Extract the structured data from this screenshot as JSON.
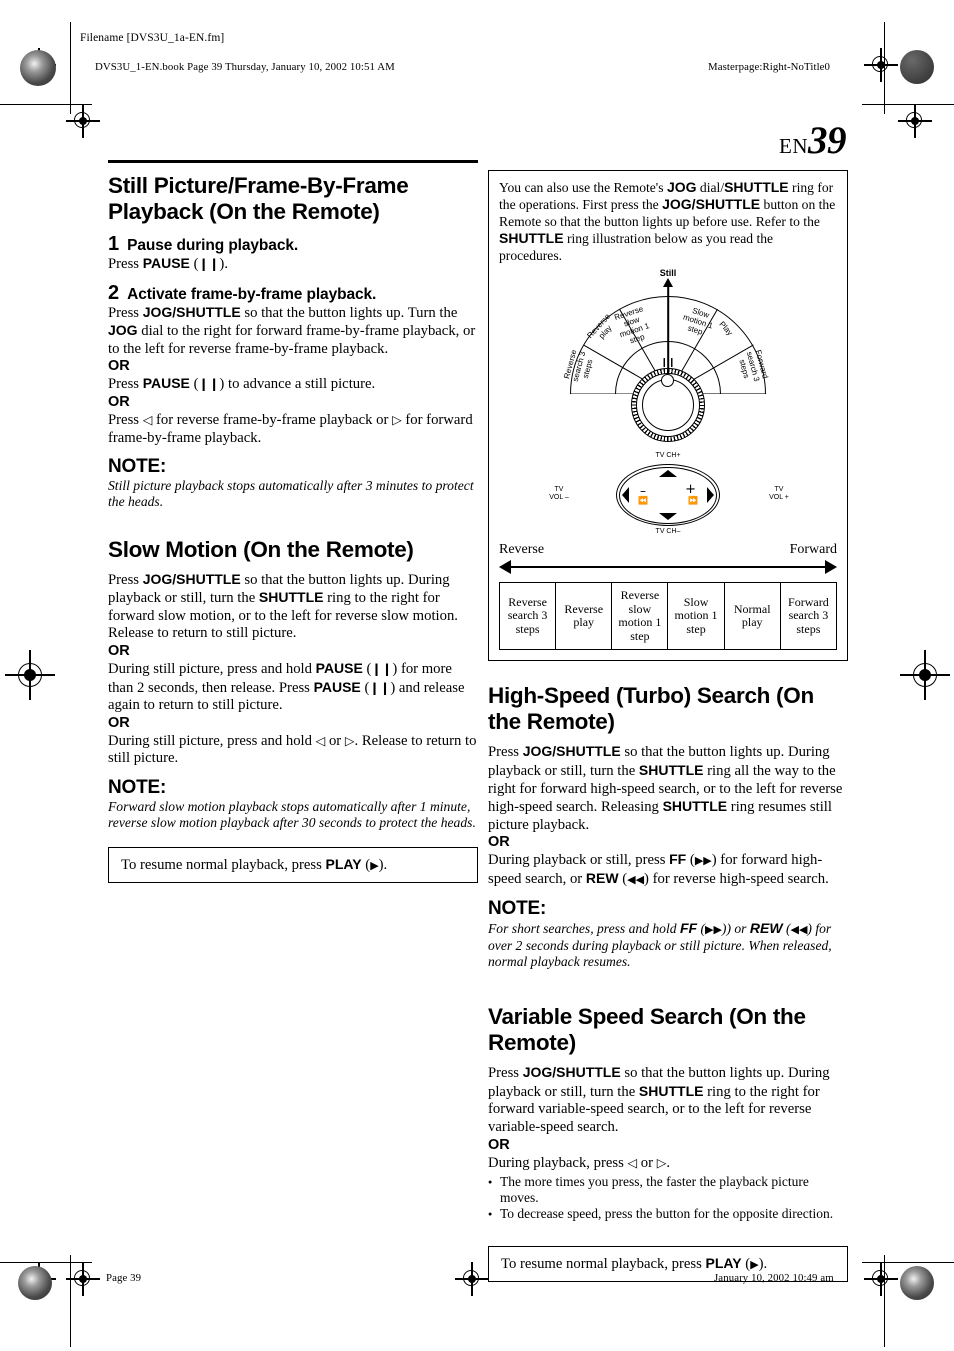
{
  "header": {
    "filename_label": "Filename [DVS3U_1a-EN.fm]",
    "book_line": "DVS3U_1-EN.book  Page 39  Thursday, January 10, 2002  10:51 AM",
    "masterpage": "Masterpage:Right-NoTitle0"
  },
  "page_number": {
    "prefix": "EN",
    "number": "39"
  },
  "footer": {
    "page_label": "Page 39",
    "timestamp": "January 10, 2002 10:49 am"
  },
  "left_column": {
    "section1": {
      "title": "Still Picture/Frame-By-Frame Playback (On the Remote)",
      "steps": [
        {
          "num": "1",
          "title": "Pause during playback.",
          "body_pre": "Press ",
          "body_bold": "PAUSE",
          "body_post": ")."
        },
        {
          "num": "2",
          "title": "Activate frame-by-frame playback."
        }
      ],
      "step2_p1_a": "Press ",
      "step2_p1_b": "JOG/SHUTTLE",
      "step2_p1_c": " so that the button lights up. Turn the ",
      "step2_p1_d": "JOG",
      "step2_p1_e": " dial to the right for forward frame-by-frame playback, or to the left for reverse frame-by-frame playback.",
      "or": "OR",
      "step2_p2_a": "Press ",
      "step2_p2_b": "PAUSE",
      "step2_p2_c": ") to advance a still picture.",
      "step2_p3_a": "Press ",
      "step2_p3_b": " for reverse frame-by-frame playback or ",
      "step2_p3_c": " for forward frame-by-frame playback.",
      "note_label": "NOTE:",
      "note_text": "Still picture playback stops automatically after 3 minutes to protect the heads."
    },
    "section2": {
      "title": "Slow Motion (On the Remote)",
      "p1_a": "Press ",
      "p1_b": "JOG/SHUTTLE",
      "p1_c": " so that the button lights up. During playback or still, turn the ",
      "p1_d": "SHUTTLE",
      "p1_e": " ring to the right for forward slow motion, or to the left for reverse slow motion. Release to return to still picture.",
      "or": "OR",
      "p2_a": "During still picture, press and hold ",
      "p2_b": "PAUSE",
      "p2_c": ") for more than 2 seconds, then release. Press ",
      "p2_d": "PAUSE",
      "p2_e": ") and release again to return to still picture.",
      "p3_a": "During still picture, press and hold ",
      "p3_b": " or ",
      "p3_c": ". Release to return to still picture.",
      "note_label": "NOTE:",
      "note_text": "Forward slow motion playback stops automatically after 1 minute, reverse slow motion playback after 30 seconds to protect the heads.",
      "resume_a": "To resume normal playback, press ",
      "resume_b": "PLAY",
      "resume_c": ")."
    }
  },
  "right_column": {
    "intro_box": {
      "p_a": "You can also use the Remote's ",
      "p_b": "JOG",
      "p_c": " dial/",
      "p_d": "SHUTTLE",
      "p_e": " ring for the operations. First press the ",
      "p_f": "JOG/SHUTTLE",
      "p_g": " button on the Remote so that the button lights up before use. Refer to the ",
      "p_h": "SHUTTLE",
      "p_i": " ring illustration below as you read the procedures.",
      "still_label": "Still",
      "ring_segments": [
        "Reverse search 3 steps",
        "Reverse play",
        "Reverse slow motion 1 step",
        "Slow motion 1 step",
        "Play",
        "Forward search 3 steps"
      ],
      "dpad_labels": {
        "top": "TV CH+",
        "bottom": "TV CH–",
        "left": "TV VOL –",
        "right": "TV VOL +"
      },
      "direction_left": "Reverse",
      "direction_right": "Forward",
      "table_cells": [
        "Reverse search 3 steps",
        "Reverse play",
        "Reverse slow motion 1 step",
        "Slow motion 1 step",
        "Normal play",
        "Forward search 3 steps"
      ]
    },
    "section3": {
      "title": "High-Speed (Turbo) Search (On the Remote)",
      "p1_a": "Press ",
      "p1_b": "JOG/SHUTTLE",
      "p1_c": " so that the button lights up. During playback or still, turn the ",
      "p1_d": "SHUTTLE",
      "p1_e": " ring all the way to the right for forward high-speed search, or to the left for reverse high-speed search. Releasing ",
      "p1_f": "SHUTTLE",
      "p1_g": " ring resumes still picture playback.",
      "or": "OR",
      "p2_a": "During playback or still, press ",
      "p2_b": "FF",
      "p2_c": ") for forward high-speed search, or ",
      "p2_d": "REW",
      "p2_e": ") for reverse high-speed search.",
      "note_label": "NOTE:",
      "note_a": "For short searches, press and hold ",
      "note_b": "FF",
      "note_c": ") or ",
      "note_d": "REW",
      "note_e": ") for over 2 seconds during playback or still picture. When released, normal playback resumes."
    },
    "section4": {
      "title": "Variable Speed Search (On the Remote)",
      "p1_a": "Press ",
      "p1_b": "JOG/SHUTTLE",
      "p1_c": " so that the button lights up. During playback or still, turn the ",
      "p1_d": "SHUTTLE",
      "p1_e": " ring to the right for forward variable-speed search, or to the left for reverse variable-speed search.",
      "or": "OR",
      "p2_a": "During playback, press ",
      "p2_b": " or ",
      "p2_c": ".",
      "bullets": [
        "The more times you press, the faster the playback picture moves.",
        "To decrease speed, press the button for the opposite direction."
      ],
      "resume_a": "To resume normal playback, press ",
      "resume_b": "PLAY",
      "resume_c": ")."
    }
  },
  "glyphs": {
    "pause": "❙❙",
    "play": "▶",
    "ff": "▶▶",
    "rew": "◀◀",
    "left_tri": "◁",
    "right_tri": "▷",
    "up_arrow": "▲"
  }
}
